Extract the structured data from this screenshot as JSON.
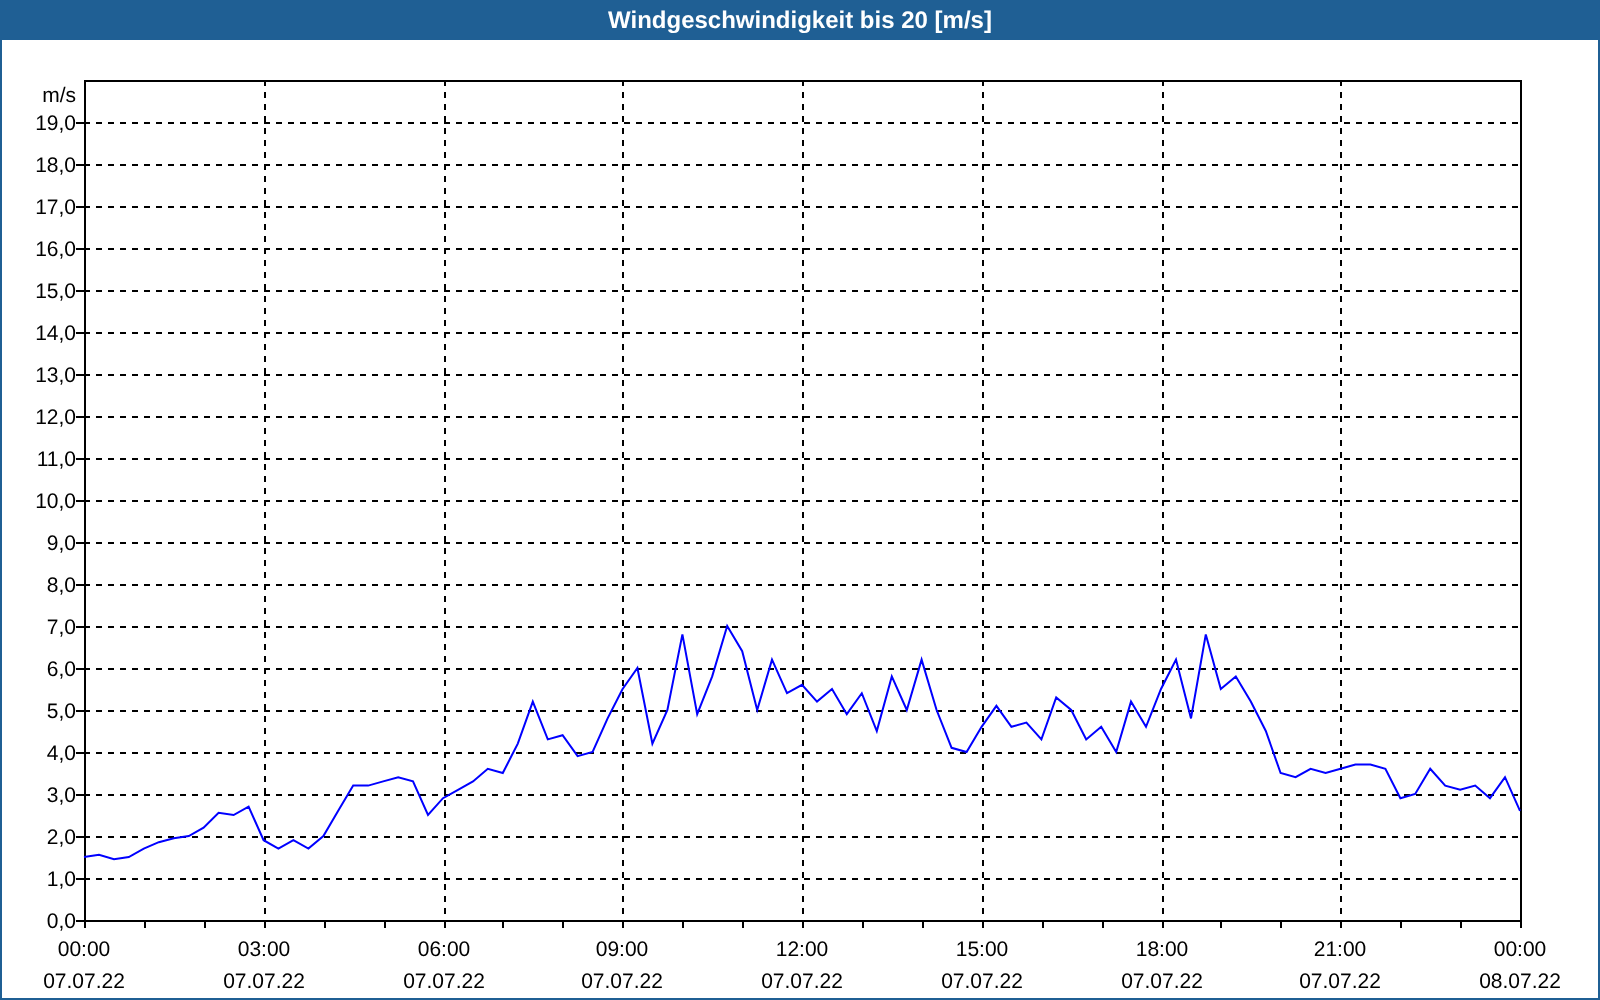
{
  "window": {
    "title": "Windgeschwindigkeit bis 20 [m/s]"
  },
  "chart": {
    "chart_data": {
      "type": "line",
      "grid": true,
      "ylabel": "m/s",
      "xlim": [
        0,
        24
      ],
      "ylim": [
        0,
        20
      ],
      "x": [
        0,
        0.25,
        0.5,
        0.75,
        1,
        1.25,
        1.5,
        1.75,
        2,
        2.25,
        2.5,
        2.75,
        3,
        3.25,
        3.5,
        3.75,
        4,
        4.25,
        4.5,
        4.75,
        5,
        5.25,
        5.5,
        5.75,
        6,
        6.25,
        6.5,
        6.75,
        7,
        7.25,
        7.5,
        7.75,
        8,
        8.25,
        8.5,
        8.75,
        9,
        9.25,
        9.5,
        9.75,
        10,
        10.25,
        10.5,
        10.75,
        11,
        11.25,
        11.5,
        11.75,
        12,
        12.25,
        12.5,
        12.75,
        13,
        13.25,
        13.5,
        13.75,
        14,
        14.25,
        14.5,
        14.75,
        15,
        15.25,
        15.5,
        15.75,
        16,
        16.25,
        16.5,
        16.75,
        17,
        17.25,
        17.5,
        17.75,
        18,
        18.25,
        18.5,
        18.75,
        19,
        19.25,
        19.5,
        19.75,
        20,
        20.25,
        20.5,
        20.75,
        21,
        21.25,
        21.5,
        21.75,
        22,
        22.25,
        22.5,
        22.75,
        23,
        23.25,
        23.5,
        23.75,
        24
      ],
      "series": [
        {
          "color": "#0000ff",
          "values": [
            1.5,
            1.55,
            1.45,
            1.5,
            1.7,
            1.85,
            1.95,
            2.0,
            2.2,
            2.55,
            2.5,
            2.7,
            1.9,
            1.7,
            1.9,
            1.7,
            2.0,
            2.6,
            3.2,
            3.2,
            3.3,
            3.4,
            3.3,
            2.5,
            2.9,
            3.1,
            3.3,
            3.6,
            3.5,
            4.2,
            5.2,
            4.3,
            4.4,
            3.9,
            4.0,
            4.8,
            5.5,
            6.0,
            4.2,
            5.0,
            6.8,
            4.9,
            5.8,
            7.0,
            6.4,
            5.0,
            6.2,
            5.4,
            5.6,
            5.2,
            5.5,
            4.9,
            5.4,
            4.5,
            5.8,
            5.0,
            6.2,
            5.0,
            4.1,
            4.0,
            4.6,
            5.1,
            4.6,
            4.7,
            4.3,
            5.3,
            5.0,
            4.3,
            4.6,
            4.0,
            5.2,
            4.6,
            5.5,
            6.2,
            4.8,
            6.8,
            5.5,
            5.8,
            5.2,
            4.5,
            3.5,
            3.4,
            3.6,
            3.5,
            3.6,
            3.7,
            3.7,
            3.6,
            2.9,
            3.0,
            3.6,
            3.2,
            3.1,
            3.2,
            2.9,
            3.4,
            2.6
          ]
        }
      ],
      "yticks": [
        {
          "value": 0,
          "label": "0,0"
        },
        {
          "value": 1,
          "label": "1,0"
        },
        {
          "value": 2,
          "label": "2,0"
        },
        {
          "value": 3,
          "label": "3,0"
        },
        {
          "value": 4,
          "label": "4,0"
        },
        {
          "value": 5,
          "label": "5,0"
        },
        {
          "value": 6,
          "label": "6,0"
        },
        {
          "value": 7,
          "label": "7,0"
        },
        {
          "value": 8,
          "label": "8,0"
        },
        {
          "value": 9,
          "label": "9,0"
        },
        {
          "value": 10,
          "label": "10,0"
        },
        {
          "value": 11,
          "label": "11,0"
        },
        {
          "value": 12,
          "label": "12,0"
        },
        {
          "value": 13,
          "label": "13,0"
        },
        {
          "value": 14,
          "label": "14,0"
        },
        {
          "value": 15,
          "label": "15,0"
        },
        {
          "value": 16,
          "label": "16,0"
        },
        {
          "value": 17,
          "label": "17,0"
        },
        {
          "value": 18,
          "label": "18,0"
        },
        {
          "value": 19,
          "label": "19,0"
        }
      ],
      "xticks": [
        {
          "value": 0,
          "label": "00:00"
        },
        {
          "value": 3,
          "label": "03:00"
        },
        {
          "value": 6,
          "label": "06:00"
        },
        {
          "value": 9,
          "label": "09:00"
        },
        {
          "value": 12,
          "label": "12:00"
        },
        {
          "value": 15,
          "label": "15:00"
        },
        {
          "value": 18,
          "label": "18:00"
        },
        {
          "value": 21,
          "label": "21:00"
        },
        {
          "value": 24,
          "label": "00:00"
        }
      ]
    },
    "x_tick_dates": [
      "07.07.22",
      "07.07.22",
      "07.07.22",
      "07.07.22",
      "07.07.22",
      "07.07.22",
      "07.07.22",
      "07.07.22",
      "08.07.22"
    ]
  }
}
